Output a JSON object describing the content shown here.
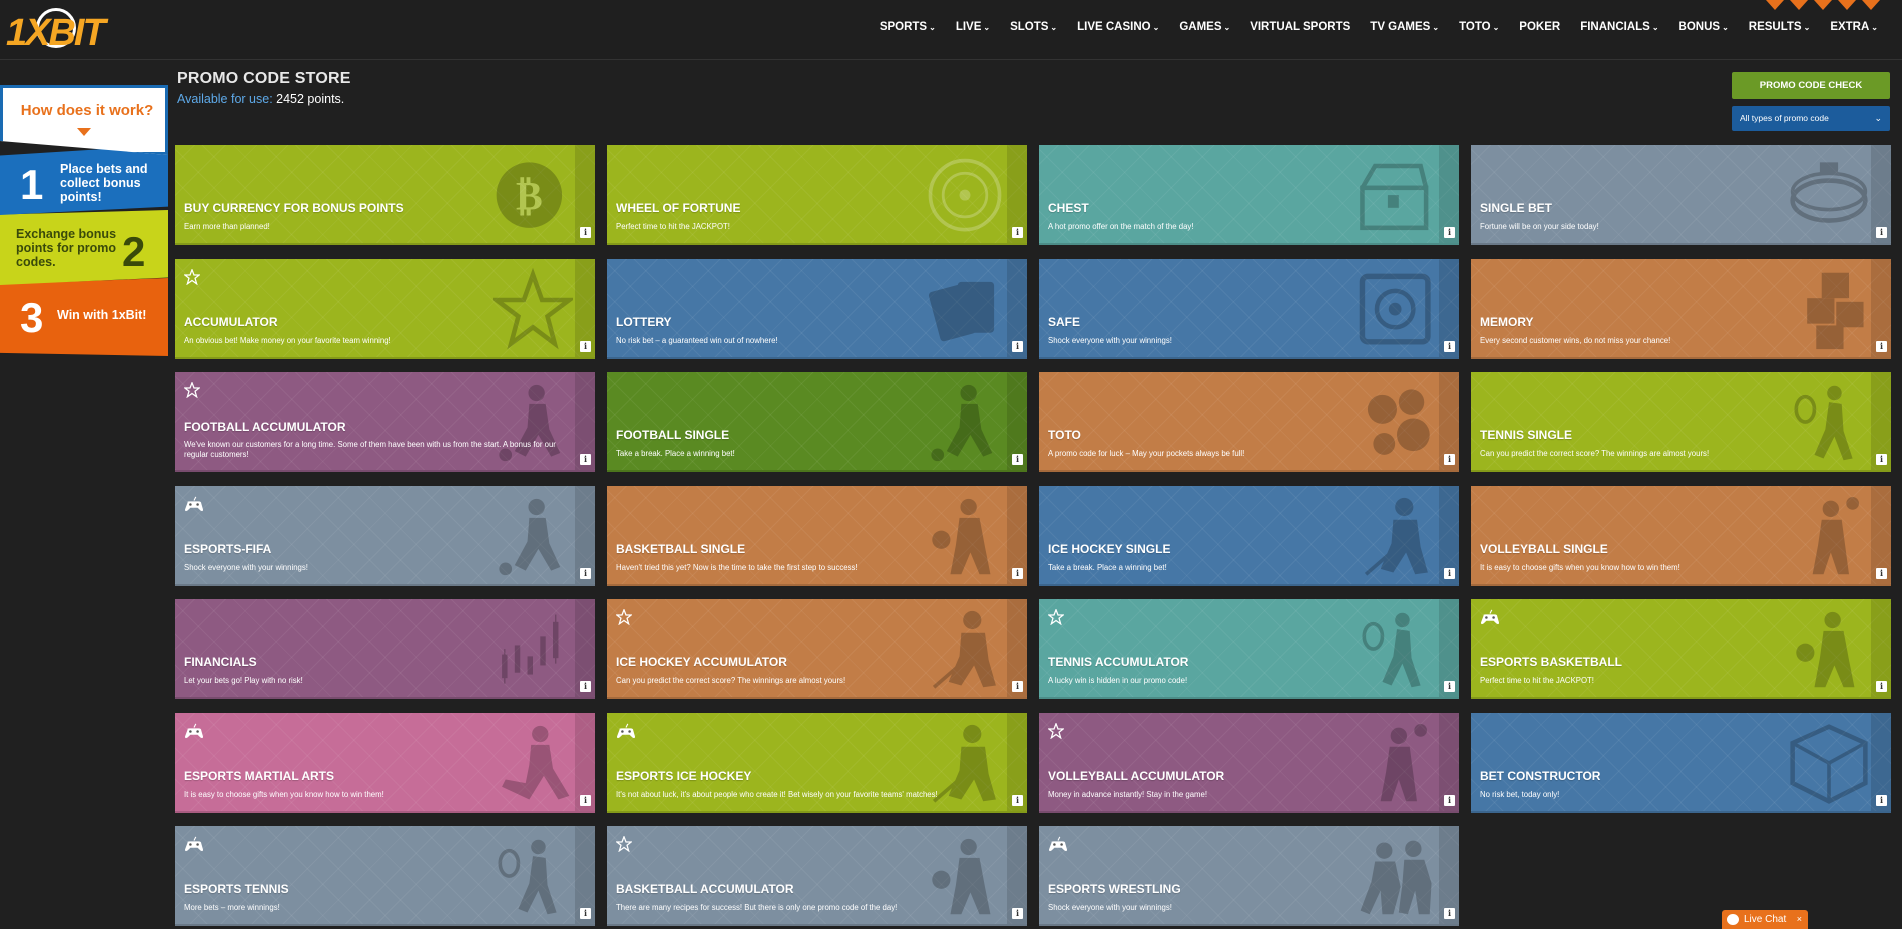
{
  "header": {
    "logo_text": "1XBIT",
    "nav": [
      {
        "label": "SPORTS",
        "dropdown": true
      },
      {
        "label": "LIVE",
        "dropdown": true
      },
      {
        "label": "SLOTS",
        "dropdown": true
      },
      {
        "label": "LIVE CASINO",
        "dropdown": true
      },
      {
        "label": "GAMES",
        "dropdown": true
      },
      {
        "label": "VIRTUAL SPORTS",
        "dropdown": false
      },
      {
        "label": "TV GAMES",
        "dropdown": true
      },
      {
        "label": "TOTO",
        "dropdown": true
      },
      {
        "label": "POKER",
        "dropdown": false
      },
      {
        "label": "FINANCIALS",
        "dropdown": true
      },
      {
        "label": "BONUS",
        "dropdown": true
      },
      {
        "label": "RESULTS",
        "dropdown": true
      },
      {
        "label": "EXTRA",
        "dropdown": true
      }
    ]
  },
  "how": {
    "title": "How does it work?",
    "steps": [
      {
        "num": "1",
        "text": "Place bets and collect bonus points!"
      },
      {
        "num": "2",
        "text": "Exchange bonus points for promo codes."
      },
      {
        "num": "3",
        "text": "Win with 1xBit!"
      }
    ]
  },
  "page": {
    "title": "PROMO CODE STORE",
    "available_label": "Available for use:",
    "available_value": "2452 points."
  },
  "controls": {
    "promo_check": "PROMO CODE CHECK",
    "type_select": "All types of promo code"
  },
  "cards": [
    {
      "title": "BUY CURRENCY FOR BONUS POINTS",
      "desc": "Earn more than planned!",
      "color": "lime",
      "badge": "",
      "icon": "bitcoin-icon"
    },
    {
      "title": "WHEEL OF FORTUNE",
      "desc": "Perfect time to hit the JACKPOT!",
      "color": "lime",
      "badge": "",
      "icon": "wheel-icon"
    },
    {
      "title": "CHEST",
      "desc": "A hot promo offer on the match of the day!",
      "color": "teal",
      "badge": "",
      "icon": "chest-icon"
    },
    {
      "title": "SINGLE BET",
      "desc": "Fortune will be on your side today!",
      "color": "slate",
      "badge": "",
      "icon": "stadium-icon"
    },
    {
      "title": "ACCUMULATOR",
      "desc": "An obvious bet! Make money on your favorite team winning!",
      "color": "lime",
      "badge": "star",
      "icon": "star-icon"
    },
    {
      "title": "LOTTERY",
      "desc": "No risk bet – a guaranteed win out of nowhere!",
      "color": "blue",
      "badge": "",
      "icon": "cards-icon"
    },
    {
      "title": "SAFE",
      "desc": "Shock everyone with your winnings!",
      "color": "blue",
      "badge": "",
      "icon": "safe-icon"
    },
    {
      "title": "MEMORY",
      "desc": "Every second customer wins, do not miss your chance!",
      "color": "orange",
      "badge": "",
      "icon": "question-blocks-icon"
    },
    {
      "title": "FOOTBALL ACCUMULATOR",
      "desc": "We've known our customers for a long time. Some of them have been with us from the start. A bonus for our regular customers!",
      "color": "purple",
      "badge": "star",
      "icon": "football-player-icon"
    },
    {
      "title": "FOOTBALL SINGLE",
      "desc": "Take a break. Place a winning bet!",
      "color": "green",
      "badge": "",
      "icon": "football-player-icon"
    },
    {
      "title": "TOTO",
      "desc": "A promo code for luck – May your pockets always be full!",
      "color": "orange",
      "badge": "",
      "icon": "balls-icon"
    },
    {
      "title": "TENNIS SINGLE",
      "desc": "Can you predict the correct score? The winnings are almost yours!",
      "color": "lime",
      "badge": "",
      "icon": "tennis-player-icon"
    },
    {
      "title": "ESPORTS-FIFA",
      "desc": "Shock everyone with your winnings!",
      "color": "slate",
      "badge": "gamepad",
      "icon": "football-player-icon"
    },
    {
      "title": "BASKETBALL SINGLE",
      "desc": "Haven't tried this yet? Now is the time to take the first step to success!",
      "color": "orange",
      "badge": "",
      "icon": "basketball-player-icon"
    },
    {
      "title": "ICE HOCKEY SINGLE",
      "desc": "Take a break. Place a winning bet!",
      "color": "blue",
      "badge": "",
      "icon": "hockey-player-icon"
    },
    {
      "title": "VOLLEYBALL SINGLE",
      "desc": "It is easy to choose gifts when you know how to win them!",
      "color": "orange",
      "badge": "",
      "icon": "volleyball-player-icon"
    },
    {
      "title": "FINANCIALS",
      "desc": "Let your bets go! Play with no risk!",
      "color": "purple",
      "badge": "",
      "icon": "candlestick-chart-icon"
    },
    {
      "title": "ICE HOCKEY ACCUMULATOR",
      "desc": "Can you predict the correct score? The winnings are almost yours!",
      "color": "orange",
      "badge": "star",
      "icon": "hockey-player-icon"
    },
    {
      "title": "TENNIS ACCUMULATOR",
      "desc": "A lucky win is hidden in our promo code!",
      "color": "teal",
      "badge": "star",
      "icon": "tennis-player-icon"
    },
    {
      "title": "ESPORTS BASKETBALL",
      "desc": "Perfect time to hit the JACKPOT!",
      "color": "lime",
      "badge": "gamepad",
      "icon": "basketball-player-icon"
    },
    {
      "title": "ESPORTS MARTIAL ARTS",
      "desc": "It is easy to choose gifts when you know how to win them!",
      "color": "pink",
      "badge": "gamepad",
      "icon": "martial-artist-icon"
    },
    {
      "title": "ESPORTS ICE HOCKEY",
      "desc": "It's not about luck, it's about people who create it! Bet wisely on your favorite teams' matches!",
      "color": "lime",
      "badge": "gamepad",
      "icon": "hockey-player-icon"
    },
    {
      "title": "VOLLEYBALL ACCUMULATOR",
      "desc": "Money in advance instantly! Stay in the game!",
      "color": "purple",
      "badge": "star",
      "icon": "volleyball-player-icon"
    },
    {
      "title": "BET CONSTRUCTOR",
      "desc": "No risk bet, today only!",
      "color": "blue",
      "badge": "",
      "icon": "cube-icon"
    },
    {
      "title": "ESPORTS TENNIS",
      "desc": "More bets – more winnings!",
      "color": "slate",
      "badge": "gamepad",
      "icon": "tennis-player-icon"
    },
    {
      "title": "BASKETBALL ACCUMULATOR",
      "desc": "There are many recipes for success! But there is only one promo code of the day!",
      "color": "slate",
      "badge": "star",
      "icon": "basketball-player-icon"
    },
    {
      "title": "ESPORTS WRESTLING",
      "desc": "Shock everyone with your winnings!",
      "color": "slate",
      "badge": "gamepad",
      "icon": "wrestlers-icon"
    }
  ],
  "live_chat": "Live Chat"
}
